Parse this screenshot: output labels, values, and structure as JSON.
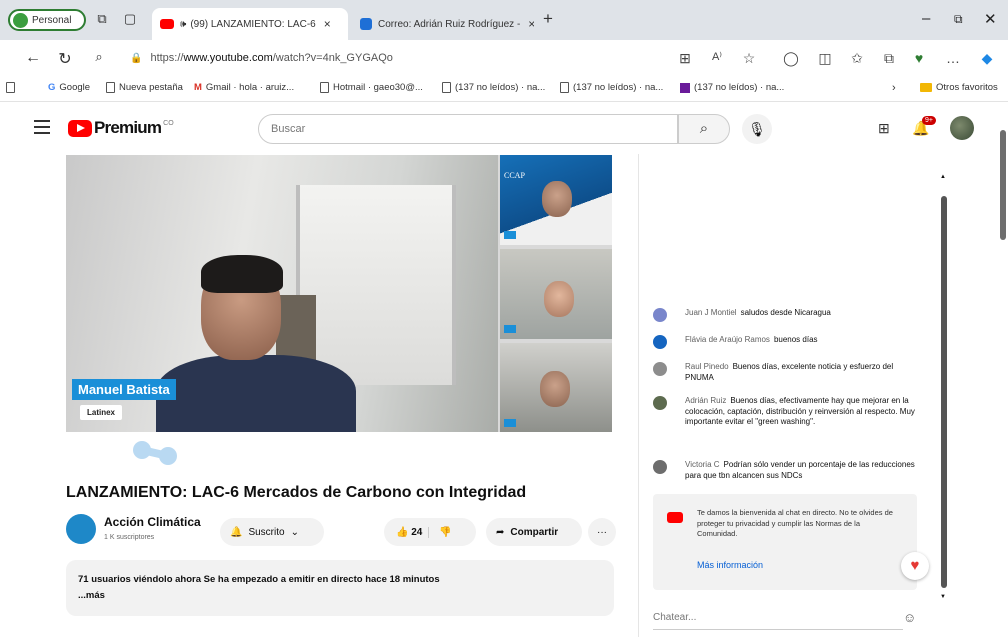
{
  "browser": {
    "profile_label": "Personal",
    "tabs": [
      {
        "label": "(99) LANZAMIENTO: LAC-6",
        "active": true,
        "color": "#ff0000"
      },
      {
        "label": "Correo: Adrián Ruiz Rodríguez -",
        "active": false,
        "color": "#1e6fd6"
      }
    ],
    "new_tab": "+",
    "url_prefix": "https://",
    "url_domain": "www.youtube.com",
    "url_path": "/watch?v=4nk_GYGAQo",
    "bookmarks": [
      "Google",
      "Nueva pestaña",
      "Gmail · hola · aruiz...",
      "Hotmail · gaeo30@...",
      "(137 no leídos) · na...",
      "(137 no leídos) · na...",
      "(137 no leídos) · na..."
    ],
    "other_favorites": "Otros favoritos"
  },
  "youtube": {
    "logo_text": "Premium",
    "logo_country": "CO",
    "search_placeholder": "Buscar",
    "notification_count": "9+"
  },
  "video": {
    "speaker_name": "Manuel Batista",
    "speaker_org": "Latinex",
    "side_brand": "CCAP",
    "title": "LANZAMIENTO: LAC-6 Mercados de Carbono con Integridad",
    "channel_name": "Acción Climática",
    "channel_subs": "1 K suscriptores",
    "subscribe_label": "Suscrito",
    "like_count": "24",
    "share_label": "Compartir",
    "more_label": "···",
    "description_line": "71 usuarios viéndolo ahora  Se ha empezado a emitir en directo hace 18 minutos",
    "description_more": "...más"
  },
  "chat": {
    "messages": [
      {
        "author": "Juan J Montiel",
        "text": "saludos desde Nicaragua",
        "color": "#7986cb"
      },
      {
        "author": "Flávia de Araújo Ramos",
        "text": "buenos días",
        "color": "#1565c0"
      },
      {
        "author": "Raul Pinedo",
        "text": "Buenos días, excelente noticia y esfuerzo del PNUMA",
        "color": "#8d8d8d"
      },
      {
        "author": "Adrián Ruiz",
        "text": "Buenos días, efectivamente hay que mejorar en la colocación, captación, distribución y reinversión al respecto. Muy importante evitar el \"green washing\".",
        "color": "#5d6b4f"
      },
      {
        "author": "Victoria C",
        "text": "Podrían sólo vender un porcentaje de las reducciones para que tbn alcancen sus NDCs",
        "color": "#6d6d6d"
      }
    ],
    "notice_text": "Te damos la bienvenida al chat en directo. No te olvides de proteger tu privacidad y cumplir las Normas de la Comunidad.",
    "notice_link": "Más información",
    "input_placeholder": "Chatear..."
  }
}
